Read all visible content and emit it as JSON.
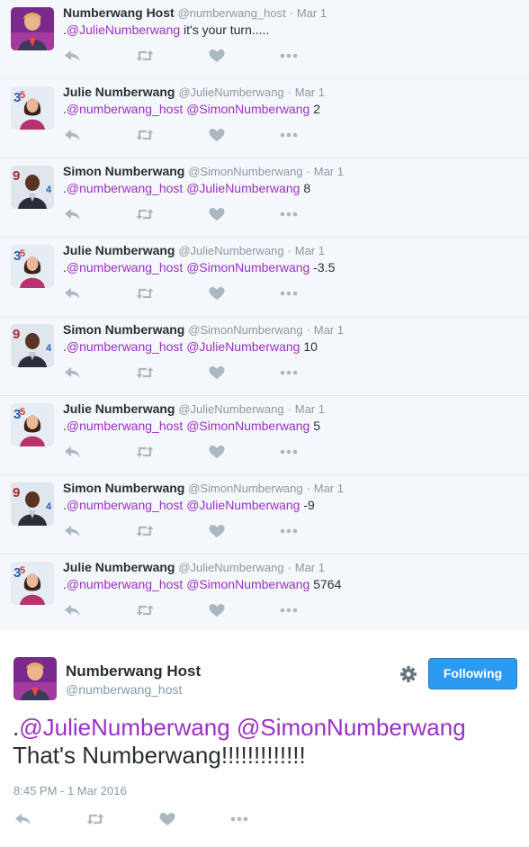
{
  "colors": {
    "mention": "#9b30c6",
    "action_icon": "#aab8c2",
    "follow_button": "#2b9af3"
  },
  "replies": [
    {
      "name": "Numberwang Host",
      "handle": "@numberwang_host",
      "date": "Mar 1",
      "prefix": ".",
      "mention1": "@JulieNumberwang",
      "mention2": "",
      "text": " it's your turn.....",
      "avatar": "host"
    },
    {
      "name": "Julie Numberwang",
      "handle": "@JulieNumberwang",
      "date": "Mar 1",
      "prefix": ".",
      "mention1": "@numberwang_host",
      "mention2": "@SimonNumberwang",
      "text": " 2",
      "avatar": "julie"
    },
    {
      "name": "Simon Numberwang",
      "handle": "@SimonNumberwang",
      "date": "Mar 1",
      "prefix": ".",
      "mention1": "@numberwang_host",
      "mention2": "@JulieNumberwang",
      "text": " 8",
      "avatar": "simon"
    },
    {
      "name": "Julie Numberwang",
      "handle": "@JulieNumberwang",
      "date": "Mar 1",
      "prefix": ".",
      "mention1": "@numberwang_host",
      "mention2": "@SimonNumberwang",
      "text": " -3.5",
      "avatar": "julie"
    },
    {
      "name": "Simon Numberwang",
      "handle": "@SimonNumberwang",
      "date": "Mar 1",
      "prefix": ".",
      "mention1": "@numberwang_host",
      "mention2": "@JulieNumberwang",
      "text": " 10",
      "avatar": "simon"
    },
    {
      "name": "Julie Numberwang",
      "handle": "@JulieNumberwang",
      "date": "Mar 1",
      "prefix": ".",
      "mention1": "@numberwang_host",
      "mention2": "@SimonNumberwang",
      "text": " 5",
      "avatar": "julie"
    },
    {
      "name": "Simon Numberwang",
      "handle": "@SimonNumberwang",
      "date": "Mar 1",
      "prefix": ".",
      "mention1": "@numberwang_host",
      "mention2": "@JulieNumberwang",
      "text": " -9",
      "avatar": "simon"
    },
    {
      "name": "Julie Numberwang",
      "handle": "@JulieNumberwang",
      "date": "Mar 1",
      "prefix": ".",
      "mention1": "@numberwang_host",
      "mention2": "@SimonNumberwang",
      "text": " 5764",
      "avatar": "julie"
    }
  ],
  "main_tweet": {
    "name": "Numberwang Host",
    "handle": "@numberwang_host",
    "follow_label": "Following",
    "prefix": ".",
    "mention1": "@JulieNumberwang",
    "mention2": "@SimonNumberwang",
    "text": "That's Numberwang!!!!!!!!!!!!!",
    "timestamp": "8:45 PM - 1 Mar 2016"
  },
  "icons": [
    "reply-icon",
    "retweet-icon",
    "like-icon",
    "more-icon",
    "gear-icon"
  ]
}
